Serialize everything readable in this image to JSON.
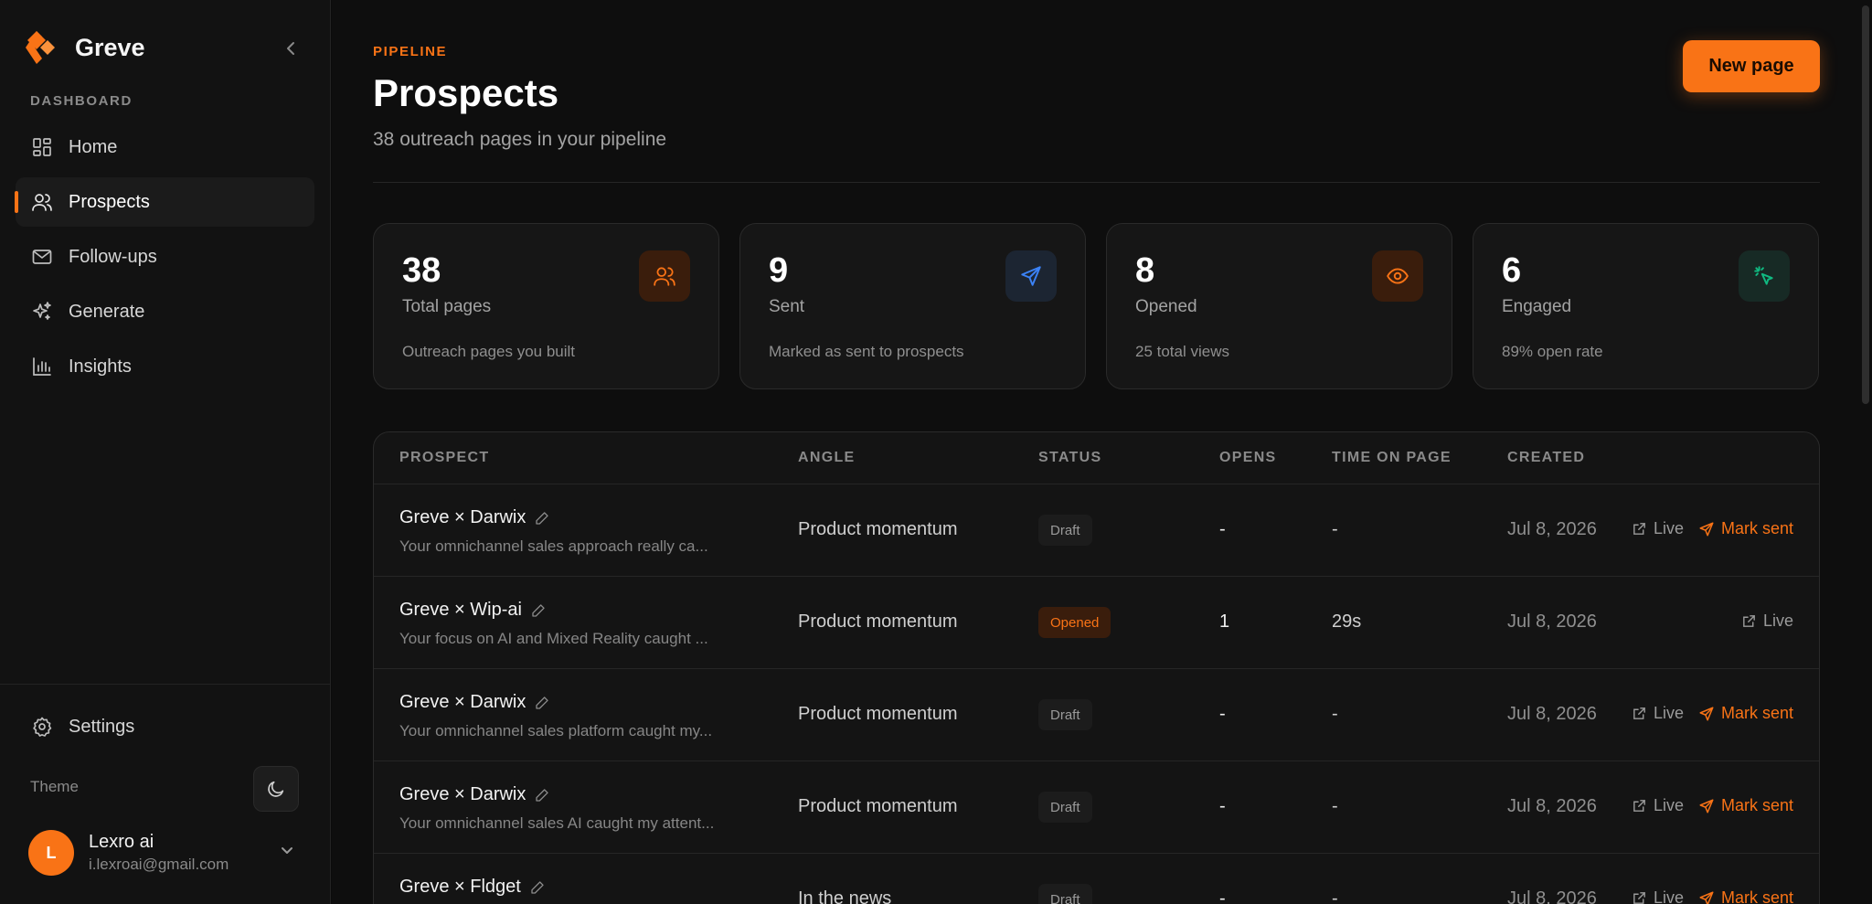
{
  "app": {
    "name": "Greve",
    "logo_color": "#f97316"
  },
  "sidebar": {
    "section_label": "DASHBOARD",
    "items": [
      {
        "label": "Home",
        "icon": "dashboard-grid-icon"
      },
      {
        "label": "Prospects",
        "icon": "users-icon",
        "active": true
      },
      {
        "label": "Follow-ups",
        "icon": "mail-icon"
      },
      {
        "label": "Generate",
        "icon": "sparkles-icon"
      },
      {
        "label": "Insights",
        "icon": "bar-chart-icon"
      }
    ],
    "settings_label": "Settings",
    "theme_label": "Theme",
    "user": {
      "initial": "L",
      "name": "Lexro ai",
      "email": "i.lexroai@gmail.com"
    }
  },
  "header": {
    "eyebrow": "PIPELINE",
    "title": "Prospects",
    "subtitle": "38 outreach pages in your pipeline",
    "new_button": "New page"
  },
  "stats": [
    {
      "value": "38",
      "label": "Total pages",
      "note": "Outreach pages you built",
      "icon": "users-icon",
      "color": "#f97316"
    },
    {
      "value": "9",
      "label": "Sent",
      "note": "Marked as sent to prospects",
      "icon": "send-icon",
      "color": "#3b82f6"
    },
    {
      "value": "8",
      "label": "Opened",
      "note": "25 total views",
      "icon": "eye-icon",
      "color": "#f97316"
    },
    {
      "value": "6",
      "label": "Engaged",
      "note": "89% open rate",
      "icon": "cursor-click-icon",
      "color": "#10b981"
    }
  ],
  "table": {
    "columns": [
      "PROSPECT",
      "ANGLE",
      "STATUS",
      "OPENS",
      "TIME ON PAGE",
      "CREATED"
    ],
    "live_label": "Live",
    "mark_sent_label": "Mark sent",
    "rows": [
      {
        "name": "Greve × Darwix",
        "desc": "Your omnichannel sales approach really ca...",
        "angle": "Product momentum",
        "status": "Draft",
        "opens": "-",
        "time": "-",
        "created": "Jul 8, 2026",
        "mark_sent": true
      },
      {
        "name": "Greve × Wip-ai",
        "desc": "Your focus on AI and Mixed Reality caught ...",
        "angle": "Product momentum",
        "status": "Opened",
        "opens": "1",
        "time": "29s",
        "created": "Jul 8, 2026",
        "mark_sent": false
      },
      {
        "name": "Greve × Darwix",
        "desc": "Your omnichannel sales platform caught my...",
        "angle": "Product momentum",
        "status": "Draft",
        "opens": "-",
        "time": "-",
        "created": "Jul 8, 2026",
        "mark_sent": true
      },
      {
        "name": "Greve × Darwix",
        "desc": "Your omnichannel sales AI caught my attent...",
        "angle": "Product momentum",
        "status": "Draft",
        "opens": "-",
        "time": "-",
        "created": "Jul 8, 2026",
        "mark_sent": true
      },
      {
        "name": "Greve × Fldget",
        "desc": "",
        "angle": "In the news",
        "status": "Draft",
        "opens": "-",
        "time": "-",
        "created": "Jul 8, 2026",
        "mark_sent": true
      }
    ]
  }
}
